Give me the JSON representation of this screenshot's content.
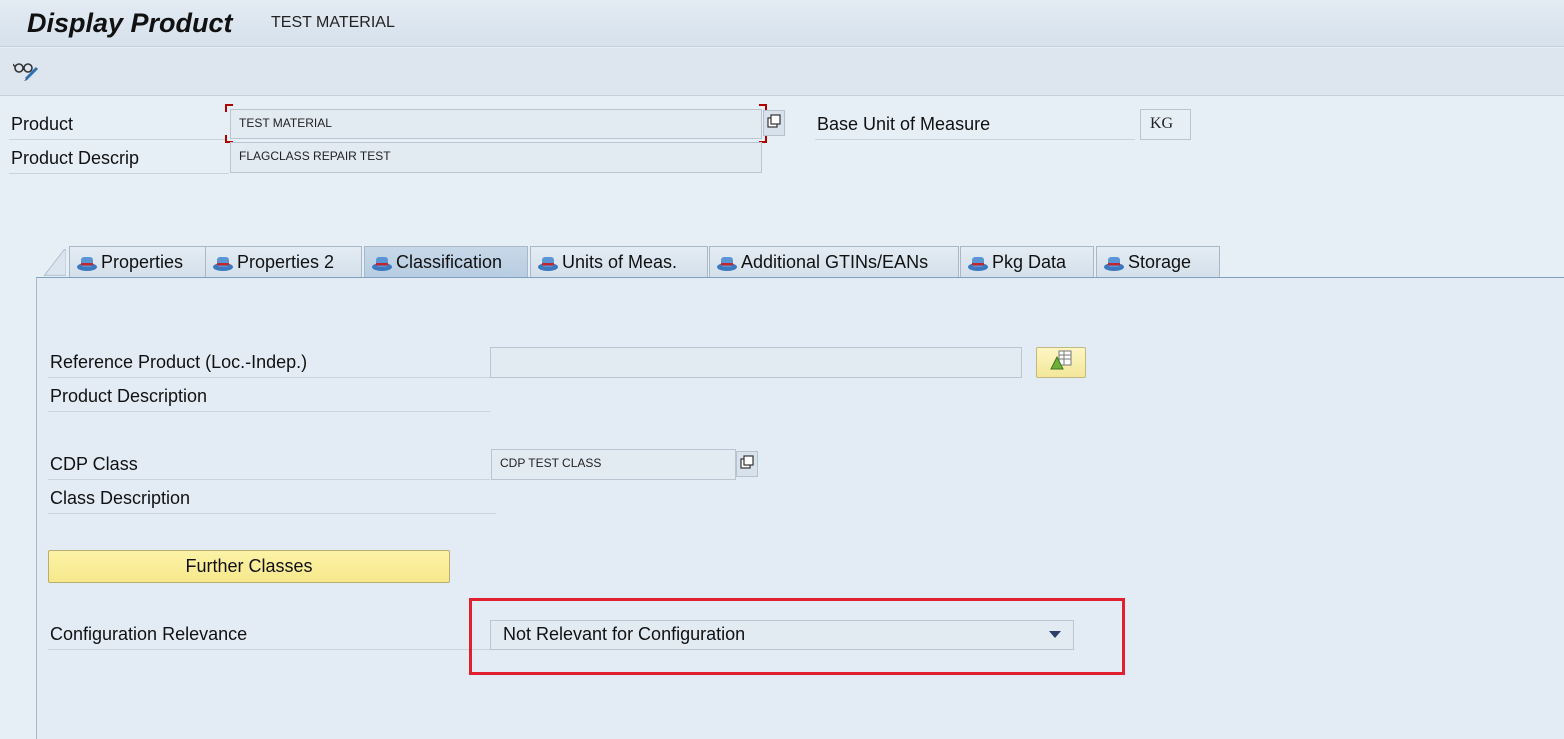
{
  "window": {
    "title": "Display Product",
    "subtitle": "TEST MATERIAL"
  },
  "toolbar": {
    "display_change_icon": "glasses-pencil-icon"
  },
  "header": {
    "product_label": "Product",
    "product_value": "TEST MATERIAL",
    "product_desc_label": "Product Descrip",
    "product_desc_value": "FLAGCLASS REPAIR TEST",
    "base_uom_label": "Base Unit of Measure",
    "base_uom_value": "KG"
  },
  "tabs": [
    {
      "label": "Properties",
      "active": false
    },
    {
      "label": "Properties 2",
      "active": false
    },
    {
      "label": "Classification",
      "active": true
    },
    {
      "label": "Units of Meas.",
      "active": false
    },
    {
      "label": "Additional GTINs/EANs",
      "active": false
    },
    {
      "label": "Pkg Data",
      "active": false
    },
    {
      "label": "Storage",
      "active": false
    }
  ],
  "classification": {
    "ref_product_label": "Reference Product (Loc.-Indep.)",
    "ref_product_value": "",
    "product_description_label": "Product Description",
    "cdp_class_label": "CDP Class",
    "cdp_class_value": "CDP TEST CLASS",
    "class_description_label": "Class Description",
    "further_classes_button": "Further Classes",
    "config_relevance_label": "Configuration Relevance",
    "config_relevance_value": "Not Relevant for Configuration"
  },
  "colors": {
    "highlight_box": "#e0202e",
    "button_yellow": "#f7e88c",
    "background": "#e6eef6"
  }
}
